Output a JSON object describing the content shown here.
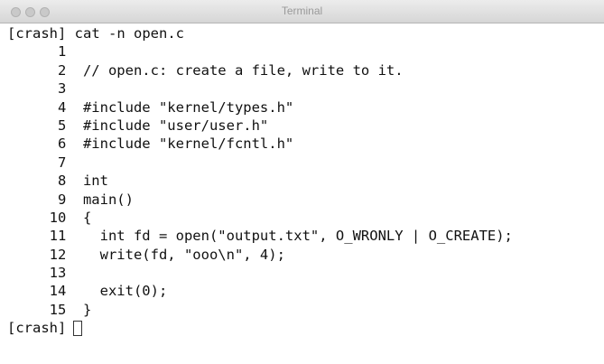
{
  "window": {
    "title": "Terminal"
  },
  "session": {
    "prompt": "[crash]",
    "command": "cat -n open.c"
  },
  "lines": [
    {
      "n": "1",
      "code": ""
    },
    {
      "n": "2",
      "code": "// open.c: create a file, write to it."
    },
    {
      "n": "3",
      "code": ""
    },
    {
      "n": "4",
      "code": "#include \"kernel/types.h\""
    },
    {
      "n": "5",
      "code": "#include \"user/user.h\""
    },
    {
      "n": "6",
      "code": "#include \"kernel/fcntl.h\""
    },
    {
      "n": "7",
      "code": ""
    },
    {
      "n": "8",
      "code": "int"
    },
    {
      "n": "9",
      "code": "main()"
    },
    {
      "n": "10",
      "code": "{"
    },
    {
      "n": "11",
      "code": "  int fd = open(\"output.txt\", O_WRONLY | O_CREATE);"
    },
    {
      "n": "12",
      "code": "  write(fd, \"ooo\\n\", 4);"
    },
    {
      "n": "13",
      "code": ""
    },
    {
      "n": "14",
      "code": "  exit(0);"
    },
    {
      "n": "15",
      "code": "}"
    }
  ]
}
